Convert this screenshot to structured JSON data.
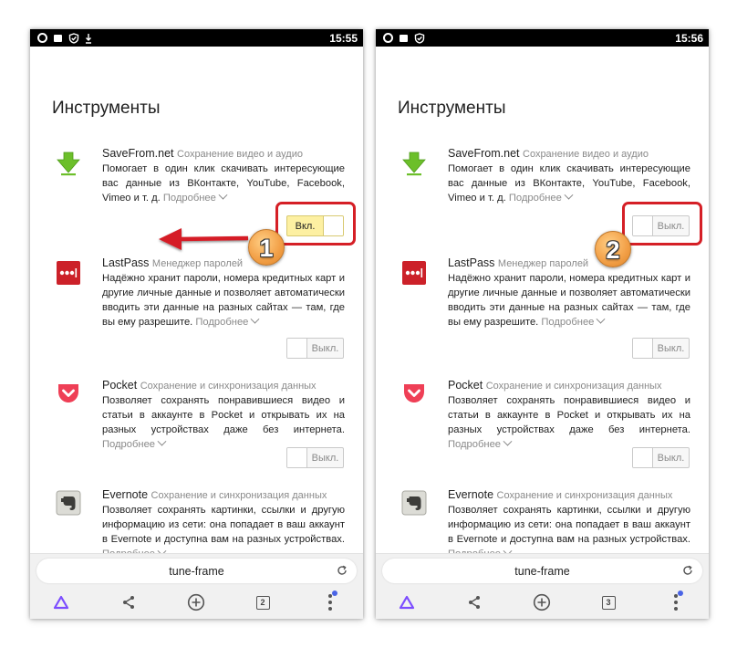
{
  "screens": [
    {
      "status": {
        "time": "15:55"
      },
      "title": "Инструменты",
      "extensions": [
        {
          "name": "SaveFrom.net",
          "category": "Сохранение видео и аудио",
          "description": "Помогает в один клик скачивать интересующие вас данные из ВКонтакте, YouTube, Facebook, Vimeo и т. д.",
          "more": "Подробнее",
          "toggle": "Вкл.",
          "enabled": true
        },
        {
          "name": "LastPass",
          "category": "Менеджер паролей",
          "description": "Надёжно хранит пароли, номера кредитных карт и другие личные данные и позволяет автоматически вводить эти данные на разных сайтах — там, где вы ему разрешите.",
          "more": "Подробнее",
          "toggle": "Выкл.",
          "enabled": false
        },
        {
          "name": "Pocket",
          "category": "Сохранение и синхронизация данных",
          "description": "Позволяет сохранять понравившиеся видео и статьи в аккаунте в Pocket и открывать их на разных устройствах даже без интернета.",
          "more": "Подробнее",
          "toggle": "Выкл.",
          "enabled": false
        },
        {
          "name": "Evernote",
          "category": "Сохранение и синхронизация данных",
          "description": "Позволяет сохранять картинки, ссылки и другую информацию из сети: она попадает в ваш аккаунт в Evernote и доступна вам на разных устройствах.",
          "more": "Подробнее"
        }
      ],
      "url": "tune-frame",
      "tab_count": "2"
    },
    {
      "status": {
        "time": "15:56"
      },
      "title": "Инструменты",
      "extensions": [
        {
          "name": "SaveFrom.net",
          "category": "Сохранение видео и аудио",
          "description": "Помогает в один клик скачивать интересующие вас данные из ВКонтакте, YouTube, Facebook, Vimeo и т. д.",
          "more": "Подробнее",
          "toggle": "Выкл.",
          "enabled": false
        },
        {
          "name": "LastPass",
          "category": "Менеджер паролей",
          "description": "Надёжно хранит пароли, номера кредитных карт и другие личные данные и позволяет автоматически вводить эти данные на разных сайтах — там, где вы ему разрешите.",
          "more": "Подробнее",
          "toggle": "Выкл.",
          "enabled": false
        },
        {
          "name": "Pocket",
          "category": "Сохранение и синхронизация данных",
          "description": "Позволяет сохранять понравившиеся видео и статьи в аккаунте в Pocket и открывать их на разных устройствах даже без интернета.",
          "more": "Подробнее",
          "toggle": "Выкл.",
          "enabled": false
        },
        {
          "name": "Evernote",
          "category": "Сохранение и синхронизация данных",
          "description": "Позволяет сохранять картинки, ссылки и другую информацию из сети: она попадает в ваш аккаунт в Evernote и доступна вам на разных устройствах.",
          "more": "Подробнее"
        }
      ],
      "url": "tune-frame",
      "tab_count": "3"
    }
  ],
  "annotations": {
    "step1": "1",
    "step2": "2"
  },
  "icons": [
    "opera-icon",
    "notification-icon",
    "shield-check-icon",
    "download-icon",
    "savefrom-arrow-icon",
    "lastpass-icon",
    "pocket-icon",
    "evernote-icon",
    "reload-icon",
    "alice-icon",
    "share-icon",
    "new-tab-icon",
    "tabs-icon",
    "menu-icon"
  ],
  "colors": {
    "highlight": "#d51f26",
    "arrow": "#d51f26",
    "toggle_on": "#fdf0a2",
    "savefrom": "#6cbf2a",
    "lastpass": "#cc2129",
    "pocket": "#ef3f56",
    "alice": "#7c4dff",
    "menu_badge": "#4a64e6"
  }
}
